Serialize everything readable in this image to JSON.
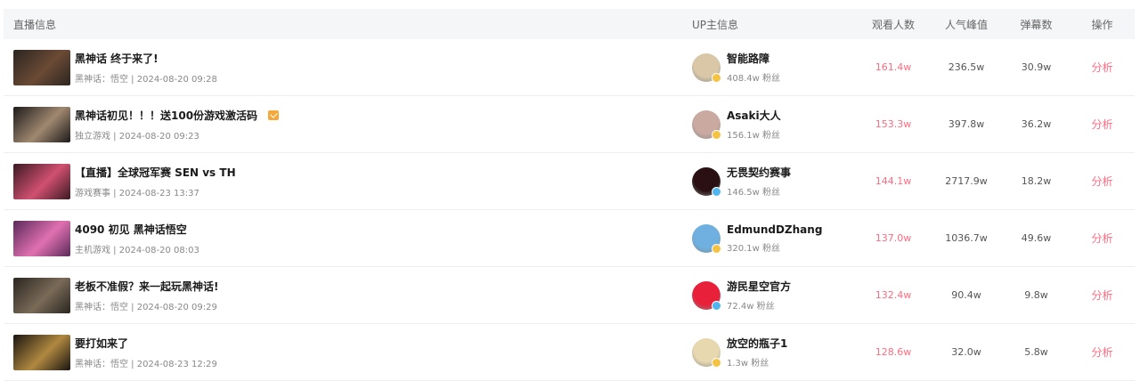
{
  "header": {
    "live_info": "直播信息",
    "up_info": "UP主信息",
    "viewers": "观看人数",
    "peak": "人气峰值",
    "danmaku": "弹幕数",
    "action": "操作"
  },
  "rows": [
    {
      "title": "黑神话 终于来了!",
      "has_badge": false,
      "meta": "黑神话：悟空 | 2024-08-20 09:28",
      "thumb_colors": [
        "#2b2520",
        "#6b4a35"
      ],
      "up_name": "智能路障",
      "fans": "408.4w 粉丝",
      "avatar_color": "#d9c7a8",
      "verify_color": "#f5c242",
      "viewers": "161.4w",
      "peak": "236.5w",
      "danmaku": "30.9w",
      "action": "分析"
    },
    {
      "title": "黑神话初见！！！送100份游戏激活码",
      "has_badge": true,
      "meta": "独立游戏 | 2024-08-20 09:23",
      "thumb_colors": [
        "#1c1a1a",
        "#a08870"
      ],
      "up_name": "Asaki大人",
      "fans": "156.1w 粉丝",
      "avatar_color": "#c9a9a0",
      "verify_color": "#f5c242",
      "viewers": "153.3w",
      "peak": "397.8w",
      "danmaku": "36.2w",
      "action": "分析"
    },
    {
      "title": "【直播】全球冠军赛 SEN vs TH",
      "has_badge": false,
      "meta": "游戏赛事 | 2024-08-23 13:37",
      "thumb_colors": [
        "#3a1a22",
        "#d05070"
      ],
      "up_name": "无畏契约赛事",
      "fans": "146.5w 粉丝",
      "avatar_color": "#2a1012",
      "verify_color": "#4fb6f0",
      "viewers": "144.1w",
      "peak": "2717.9w",
      "danmaku": "18.2w",
      "action": "分析"
    },
    {
      "title": "4090 初见 黑神话悟空",
      "has_badge": false,
      "meta": "主机游戏 | 2024-08-20 08:03",
      "thumb_colors": [
        "#5a2a5a",
        "#e070b0"
      ],
      "up_name": "EdmundDZhang",
      "fans": "320.1w 粉丝",
      "avatar_color": "#6fb0e0",
      "verify_color": "#f5c242",
      "viewers": "137.0w",
      "peak": "1036.7w",
      "danmaku": "49.6w",
      "action": "分析"
    },
    {
      "title": "老板不准假？来一起玩黑神话!",
      "has_badge": false,
      "meta": "黑神话：悟空 | 2024-08-20 09:29",
      "thumb_colors": [
        "#2a2620",
        "#7a6a58"
      ],
      "up_name": "游民星空官方",
      "fans": "72.4w 粉丝",
      "avatar_color": "#e8203a",
      "verify_color": "#4fb6f0",
      "viewers": "132.4w",
      "peak": "90.4w",
      "danmaku": "9.8w",
      "action": "分析"
    },
    {
      "title": "要打如来了",
      "has_badge": false,
      "meta": "黑神话：悟空 | 2024-08-23 12:29",
      "thumb_colors": [
        "#1a1510",
        "#b08840"
      ],
      "up_name": "放空的瓶子1",
      "fans": "1.3w 粉丝",
      "avatar_color": "#e8d8b0",
      "verify_color": "#f5c242",
      "viewers": "128.6w",
      "peak": "32.0w",
      "danmaku": "5.8w",
      "action": "分析"
    }
  ]
}
